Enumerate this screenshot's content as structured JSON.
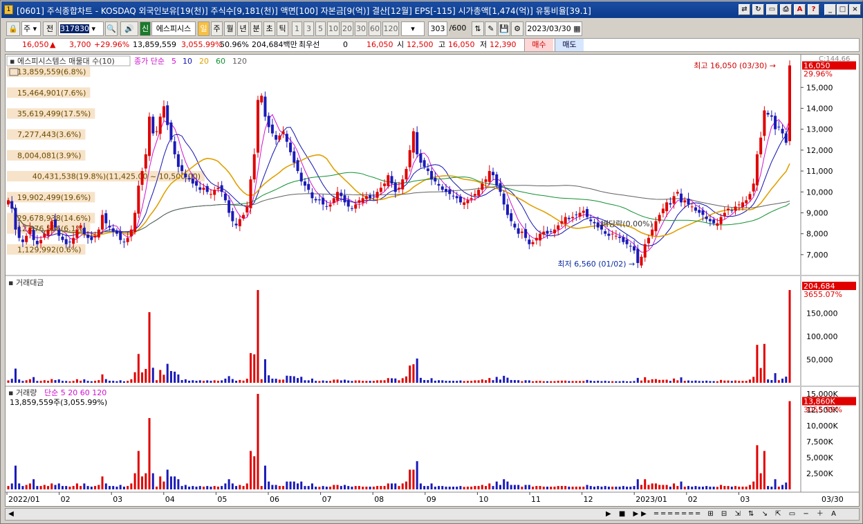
{
  "window": {
    "title": "[0601] 주식종합차트 - KOSDAQ 외국인보유[19(천)] 주식수[9,181(천)] 액면[100] 자본금[9(억)] 결산[12월] EPS[-115] 시가총액[1,474(억)] 유통비율[39.1]",
    "icon": "1"
  },
  "toolbar": {
    "mode": "주",
    "prev_label": "전",
    "code": "317830",
    "search_icon": "magnifier-icon",
    "new_label": "신",
    "company": "에스피시스",
    "periods": [
      "일",
      "주",
      "월",
      "년",
      "분",
      "초",
      "틱"
    ],
    "active_period": "일",
    "intervals": [
      "1",
      "3",
      "5",
      "10",
      "20",
      "30",
      "60",
      "120"
    ],
    "count": "303",
    "total": "/600",
    "date": "2023/03/30"
  },
  "info": {
    "price": "16,050",
    "change": "3,700",
    "pct": "+29.96%",
    "volume": "13,859,559",
    "vol_pct": "3,055.99%",
    "ratio": "50.96%",
    "amount": "204,684백만",
    "prefer_label": "최우선",
    "prefer": "0",
    "ask": "16,050",
    "open_label": "시",
    "open": "12,500",
    "high_label": "고",
    "high": "16,050",
    "low_label": "저",
    "low": "12,390",
    "buy": "매수",
    "sell": "매도"
  },
  "chart_data": {
    "type": "candlestick",
    "legend": {
      "name": "에스피시스템스 매물대 수(10)",
      "ma_label": "종가 단순",
      "periods": [
        "5",
        "10",
        "20",
        "60",
        "120"
      ],
      "colors": [
        "#d010d0",
        "#1010b0",
        "#e0a000",
        "#109030",
        "#606060"
      ]
    },
    "axis": {
      "price_ticks": [
        "15,000",
        "14,000",
        "13,000",
        "12,000",
        "11,000",
        "10,000",
        "9,000",
        "8,000",
        "7,000"
      ],
      "top_label": "C:144.66",
      "current": "16,050",
      "current_pct": "29.96%"
    },
    "volume_profile": [
      {
        "label": "1,129,992(0.6%)",
        "from": 7000,
        "to": 7500
      },
      {
        "label": "12,376,556(6.1%)",
        "from": 8000,
        "to": 8500
      },
      {
        "label": "29,678,938(14.6%)",
        "from": 8500,
        "to": 9000
      },
      {
        "label": "19,902,499(19.6%)",
        "from": 9500,
        "to": 10000
      },
      {
        "label": "40,431,538(19.8%)(11,425.00 ~ 10,500.00)",
        "from": 10500,
        "to": 11000
      },
      {
        "label": "8,004,081(3.9%)",
        "from": 11500,
        "to": 12000
      },
      {
        "label": "7,277,443(3.6%)",
        "from": 12500,
        "to": 13000
      },
      {
        "label": "35,619,499(17.5%)",
        "from": 13500,
        "to": 14000
      },
      {
        "label": "15,464,901(7.6%)",
        "from": 14500,
        "to": 15000
      },
      {
        "label": "13,859,559(6.8%)",
        "from": 15500,
        "to": 16000
      }
    ],
    "high_marker": "최고 16,050 (03/30)",
    "low_marker": "최저 6,560 (01/02)",
    "dividend_marker": "배당락(0.00%)",
    "closes": [
      9600,
      9200,
      8200,
      7800,
      7600,
      7900,
      8300,
      7700,
      7500,
      7700,
      8000,
      8200,
      8600,
      8300,
      7900,
      7700,
      7500,
      7600,
      7800,
      8200,
      8400,
      8000,
      7800,
      7700,
      7900,
      8200,
      8900,
      8500,
      8300,
      8100,
      8000,
      7700,
      7600,
      7800,
      8200,
      9000,
      10300,
      11000,
      11800,
      13600,
      12800,
      12900,
      13600,
      14100,
      13200,
      12500,
      11800,
      11200,
      11000,
      10700,
      10600,
      10400,
      10300,
      10100,
      10200,
      10000,
      9900,
      10100,
      10200,
      10000,
      9600,
      9000,
      8600,
      8400,
      8700,
      8900,
      9300,
      10600,
      11800,
      14400,
      14600,
      13600,
      13100,
      12800,
      12500,
      12700,
      12900,
      12400,
      11900,
      11400,
      11000,
      10500,
      10300,
      10100,
      9700,
      9600,
      9600,
      9400,
      9300,
      9400,
      9700,
      10000,
      9800,
      9500,
      9300,
      9200,
      9400,
      9600,
      9700,
      9800,
      9700,
      9800,
      10000,
      10200,
      10400,
      10800,
      10400,
      10000,
      10200,
      10600,
      11100,
      12000,
      12900,
      11800,
      11400,
      11200,
      11000,
      10600,
      10500,
      10300,
      10100,
      10000,
      9900,
      9800,
      9700,
      9500,
      9500,
      9600,
      9700,
      9900,
      10100,
      10400,
      10600,
      11000,
      10800,
      10300,
      10000,
      9400,
      8900,
      8600,
      8300,
      8000,
      8100,
      7800,
      7500,
      7600,
      7800,
      8000,
      8100,
      8000,
      8100,
      8200,
      8400,
      8600,
      8800,
      8700,
      8800,
      8900,
      9000,
      9100,
      8800,
      8600,
      8500,
      8300,
      8200,
      8000,
      7900,
      8000,
      7900,
      7800,
      7600,
      7500,
      7400,
      7200,
      6600,
      6900,
      7500,
      7800,
      8200,
      8600,
      8900,
      9200,
      9500,
      9400,
      9800,
      10000,
      9500,
      9600,
      9400,
      9300,
      9100,
      9000,
      8900,
      8700,
      8600,
      8500,
      8500,
      8800,
      9000,
      9200,
      9100,
      9300,
      9400,
      9500,
      9600,
      9900,
      10400,
      11800,
      12600,
      13900,
      13700,
      13600,
      13000,
      13100,
      12800,
      12350,
      16050
    ],
    "volume_ticks": [
      "150,000",
      "100,000",
      "50,000"
    ],
    "volume_current": "204,684",
    "volume_pct": "3655.07%",
    "amount_title": "거래대금",
    "vol_title": "거래량",
    "vol_ma": [
      "단순",
      "5",
      "20",
      "60",
      "120"
    ],
    "vol_info": "13,859,559주(3,055.99%)",
    "vol_ticks": [
      "15,000K",
      "12,500K",
      "10,000K",
      "7,500K",
      "5,000K",
      "2,500K"
    ],
    "vol_current": "13,860K",
    "vol_current_pct": "3055.99%",
    "months": [
      "2022/01",
      "02",
      "03",
      "04",
      "05",
      "06",
      "07",
      "08",
      "09",
      "10",
      "11",
      "12",
      "2023/01",
      "02",
      "03"
    ],
    "axis_end_label": "03/30"
  },
  "status_icons": [
    "play-icon",
    "stop-icon",
    "fast-forward-icon",
    "zoom-out-icon",
    "zoom-in-icon"
  ]
}
